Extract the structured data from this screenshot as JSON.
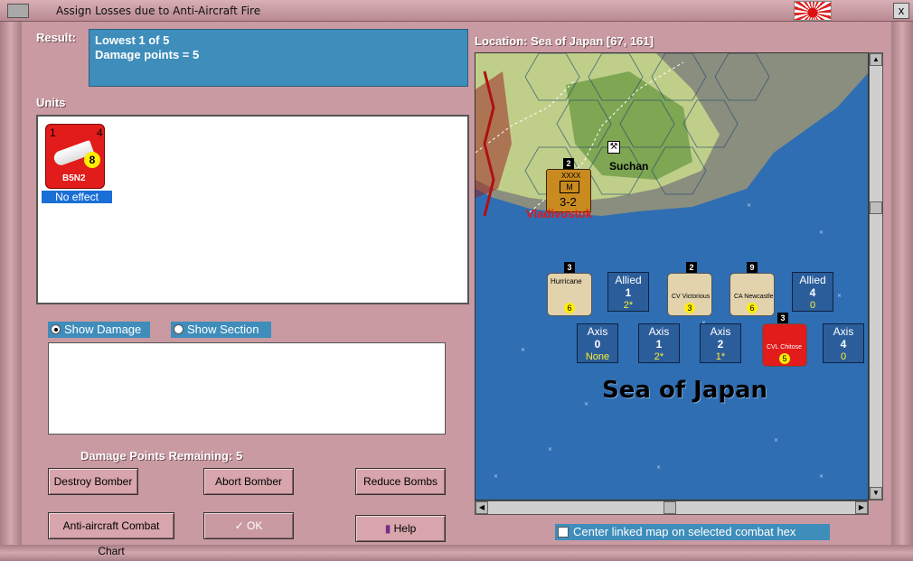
{
  "window": {
    "title": "Assign Losses due to Anti-Aircraft Fire",
    "close_glyph": "x"
  },
  "result": {
    "label": "Result:",
    "line1": "Lowest 1 of 5",
    "line2": "Damage points = 5"
  },
  "units": {
    "label": "Units",
    "items": [
      {
        "name": "B5N2",
        "top_left": "1",
        "top_right": "4",
        "badge": "8",
        "status": "No effect"
      }
    ]
  },
  "view_options": {
    "show_damage": "Show Damage",
    "show_section": "Show Section",
    "selected": "Show Damage"
  },
  "damage_remaining": {
    "label": "Damage Points Remaining:",
    "value": "5"
  },
  "buttons": {
    "destroy": "Destroy Bomber",
    "abort": "Abort Bomber",
    "reduce": "Reduce Bombs",
    "chart": "Anti-aircraft Combat Chart",
    "ok": "OK",
    "help": "Help"
  },
  "location": {
    "label": "Location:",
    "value": "Sea of Japan [67, 161]"
  },
  "map": {
    "sea_label": "Sea of Japan",
    "city1": "Vladivostok",
    "city2": "Suchan",
    "army_unit": {
      "stack": "2",
      "value": "3-2",
      "size": "XXXX"
    },
    "allied_counters": [
      {
        "side": "Allied",
        "value": "1",
        "sub": "2*"
      },
      {
        "side": "Allied",
        "value": "4",
        "sub": "0"
      }
    ],
    "axis_counters": [
      {
        "side": "Axis",
        "value": "0",
        "sub": "None"
      },
      {
        "side": "Axis",
        "value": "1",
        "sub": "2*"
      },
      {
        "side": "Axis",
        "value": "2",
        "sub": "1*"
      },
      {
        "side": "Axis",
        "value": "4",
        "sub": "0"
      }
    ],
    "chips": [
      {
        "stack": "3",
        "name": "Hurricane",
        "val": "6"
      },
      {
        "stack": "2",
        "name": "CV Victorious",
        "val": "3"
      },
      {
        "stack": "9",
        "name": "CA Newcastle",
        "val": "6"
      },
      {
        "stack": "3",
        "name": "CVL Chitose",
        "val": "5"
      }
    ]
  },
  "center_link": {
    "label": "Center linked map on selected combat hex",
    "checked": false
  },
  "colors": {
    "accent": "#3e8dbb",
    "frame": "#c99aa1",
    "sea": "#2f6eb3"
  }
}
